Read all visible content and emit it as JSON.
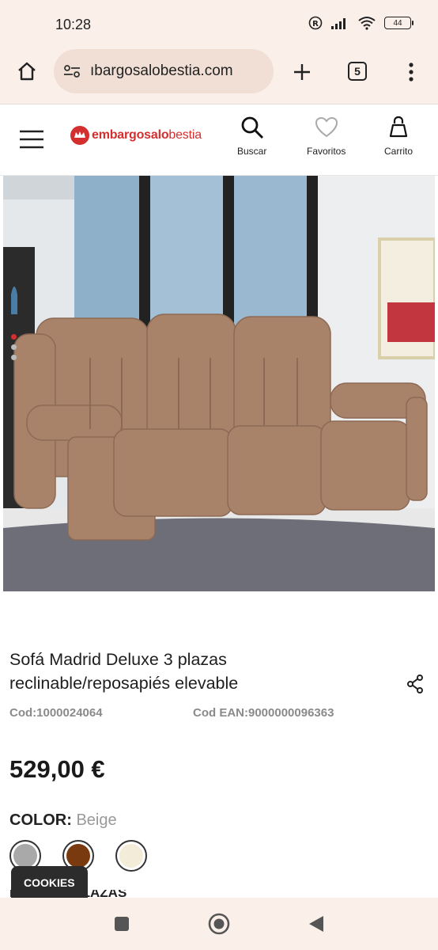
{
  "status": {
    "time": "10:28",
    "battery": "44"
  },
  "browser": {
    "url": "ıbargosalobestia.com",
    "tab_count": "5"
  },
  "site": {
    "logo_text_part1": "embargosalo",
    "logo_text_part2": "bestia",
    "search_label": "Buscar",
    "favorites_label": "Favoritos",
    "cart_label": "Carrito"
  },
  "product": {
    "title_line1": "Sofá Madrid Deluxe 3 plazas",
    "title_line2": "reclinable/reposapiés elevable",
    "code": "Cod:1000024064",
    "ean": "Cod EAN:9000000096363",
    "price": "529,00 €",
    "color_label": "COLOR:",
    "color_value": "Beige",
    "next_section": "NÚMERO PLAZAS"
  },
  "swatches": [
    {
      "name": "grey",
      "color": "#a9a9a9"
    },
    {
      "name": "brown",
      "color": "#7a3a10"
    },
    {
      "name": "beige",
      "color": "#f3ecd9"
    }
  ],
  "colors": {
    "brand_red": "#d32f2f",
    "chrome_bg": "#fbefe9"
  },
  "cookies_label": "COOKIES"
}
